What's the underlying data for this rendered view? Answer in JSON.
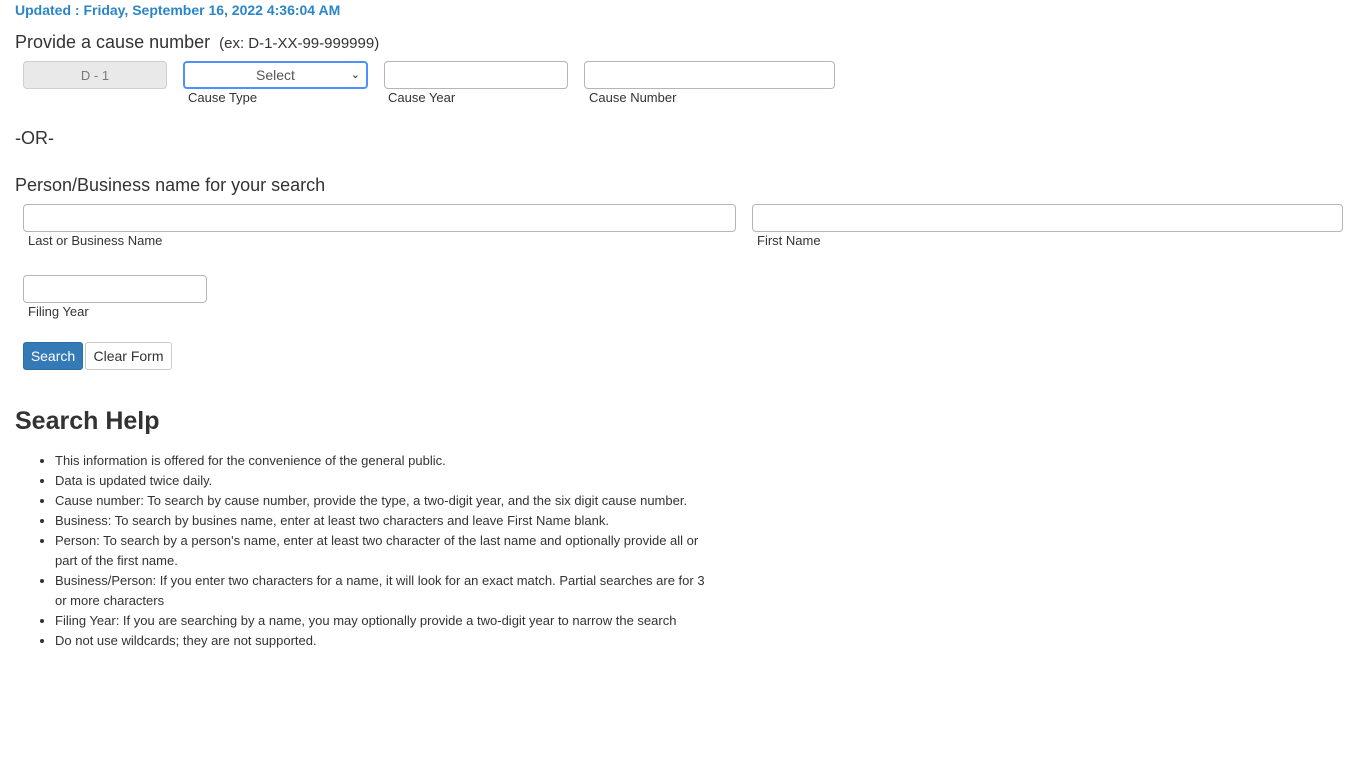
{
  "updated": "Updated : Friday, September 16, 2022 4:36:04 AM",
  "cause_section": {
    "heading": "Provide a cause number",
    "example": "(ex: D-1-XX-99-999999)",
    "prefix": "D - 1",
    "cause_type": {
      "selected": "Select",
      "label": "Cause Type"
    },
    "cause_year": {
      "value": "",
      "label": "Cause Year"
    },
    "cause_number": {
      "value": "",
      "label": "Cause Number"
    }
  },
  "or_text": "-OR-",
  "name_section": {
    "heading": "Person/Business name for your search",
    "last_name": {
      "value": "",
      "label": "Last or Business Name"
    },
    "first_name": {
      "value": "",
      "label": "First Name"
    },
    "filing_year": {
      "value": "",
      "label": "Filing Year"
    }
  },
  "buttons": {
    "search": "Search",
    "clear": "Clear Form"
  },
  "help": {
    "title": "Search Help",
    "items": [
      "This information is offered for the convenience of the general public.",
      "Data is updated twice daily.",
      "Cause number: To search by cause number, provide the type, a two-digit year, and the six digit cause number.",
      "Business: To search by busines name, enter at least two characters and leave First Name blank.",
      "Person: To search by a person's name, enter at least two character of the last name and optionally provide all or part of the first name.",
      "Business/Person: If you enter two characters for a name, it will look for an exact match. Partial searches are for 3 or more characters",
      "Filing Year: If you are searching by a name, you may optionally provide a two-digit year to narrow the search",
      "Do not use wildcards; they are not supported."
    ]
  }
}
